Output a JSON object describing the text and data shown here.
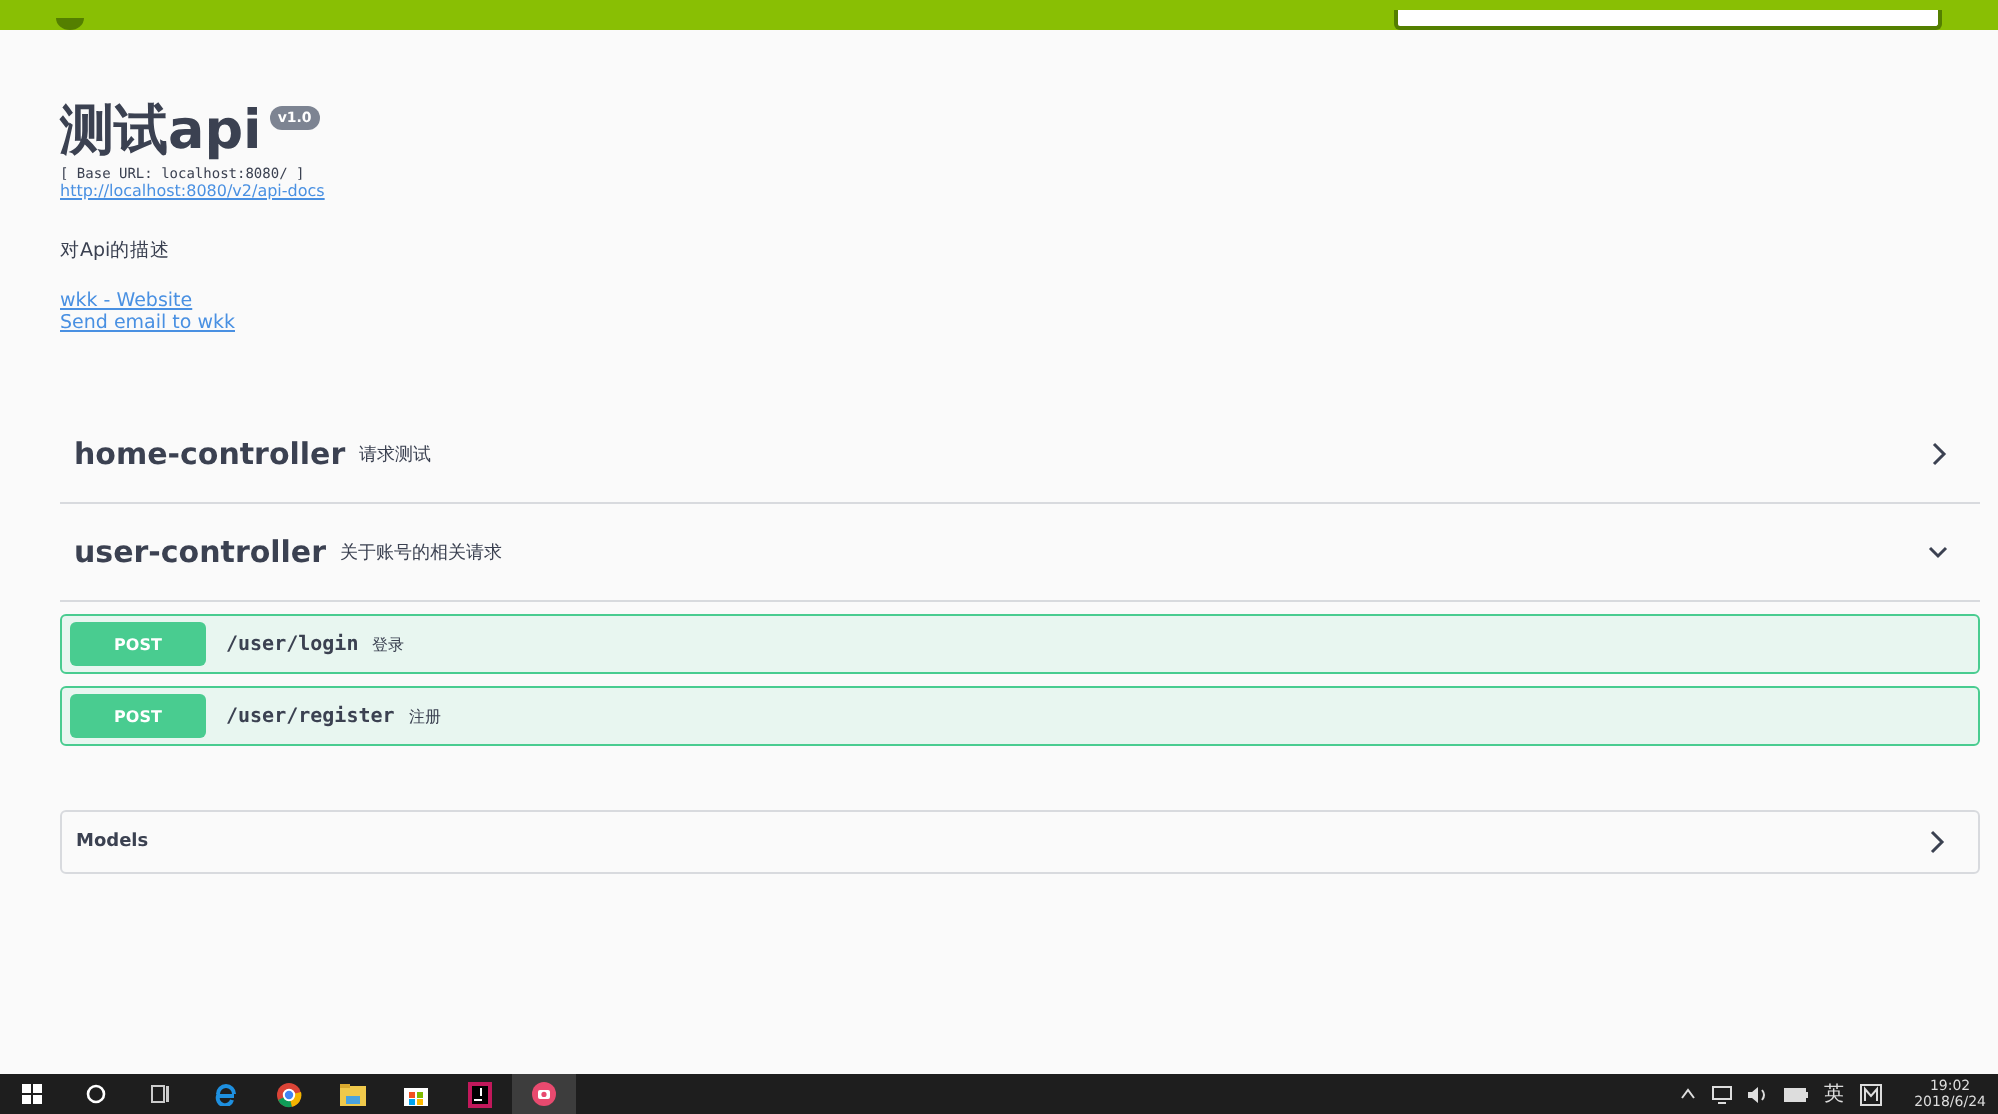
{
  "info": {
    "title": "测试api",
    "version": "v1.0",
    "base_url": "[ Base URL: localhost:8080/ ]",
    "docs_link": "http://localhost:8080/v2/api-docs",
    "description": "对Api的描述",
    "links": [
      "wkk - Website",
      "Send email to wkk"
    ]
  },
  "tags": [
    {
      "name": "home-controller",
      "description": "请求测试",
      "expanded": false
    },
    {
      "name": "user-controller",
      "description": "关于账号的相关请求",
      "expanded": true,
      "operations": [
        {
          "method": "POST",
          "path": "/user/login",
          "summary": "登录"
        },
        {
          "method": "POST",
          "path": "/user/register",
          "summary": "注册"
        }
      ]
    }
  ],
  "models": {
    "title": "Models",
    "expanded": false
  },
  "taskbar": {
    "ime": "英",
    "time": "19:02",
    "date": "2018/6/24"
  }
}
